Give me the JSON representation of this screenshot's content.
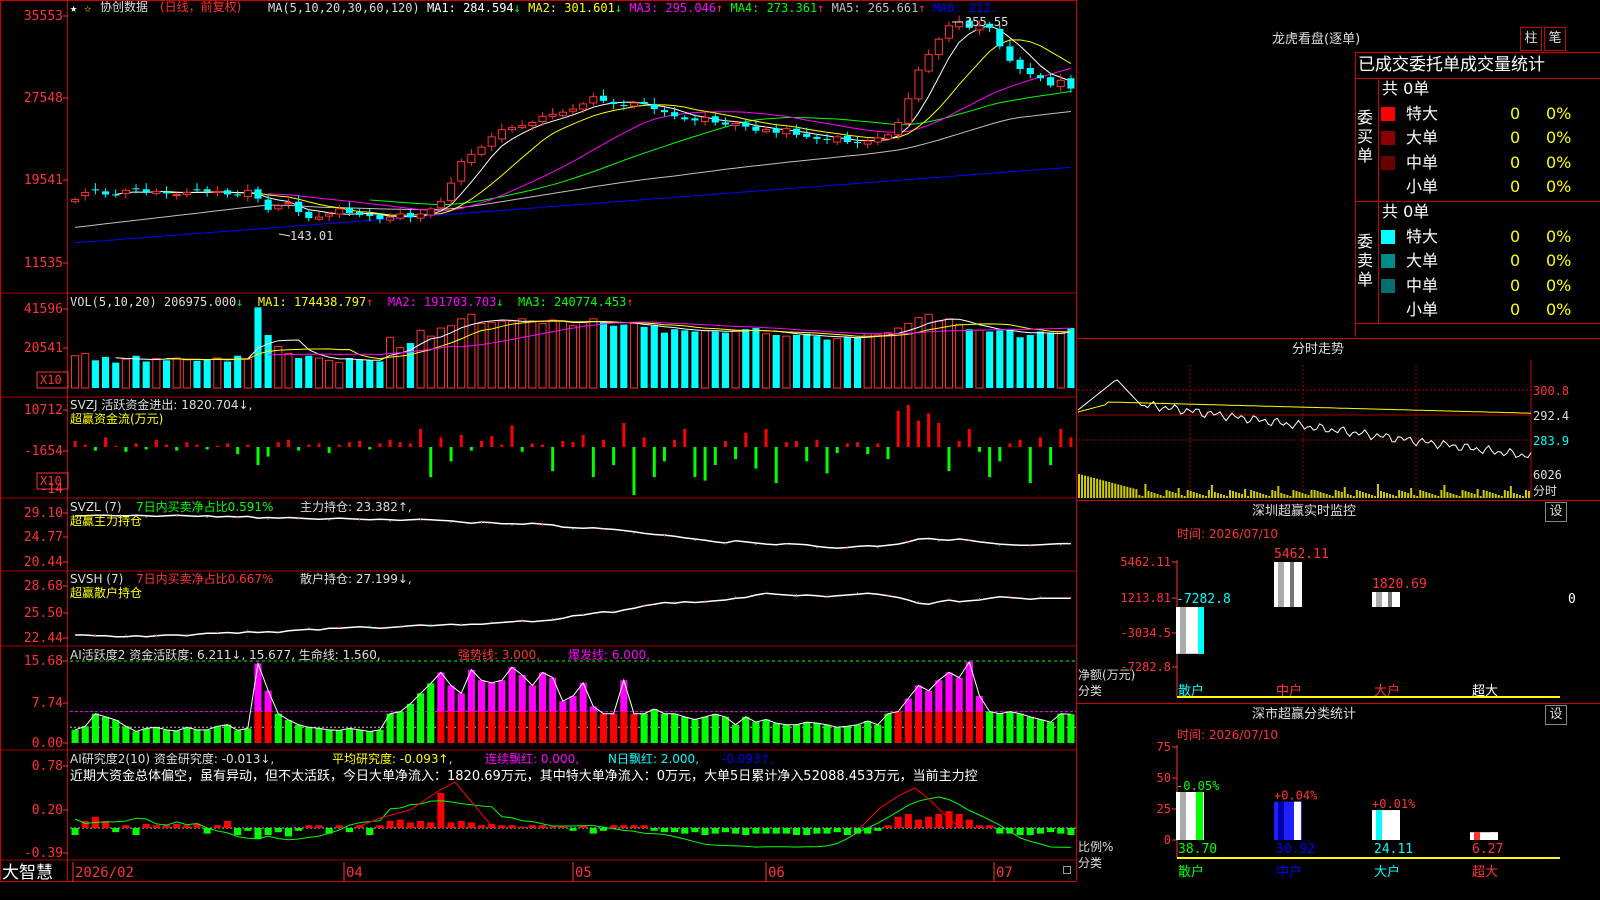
{
  "colors": {
    "up": "#ff3232",
    "down": "#00ffff",
    "grid": "#b00000",
    "ma1": "#ffffff",
    "ma2": "#ffff00",
    "ma3": "#ff00ff",
    "ma4": "#00ff00",
    "ma5": "#c0c0c0",
    "ma6": "#0000ff",
    "green": "#00ff00",
    "red": "#ff0000",
    "yellow": "#ffff00",
    "magenta": "#ff00ff",
    "cyan": "#00ffff",
    "gray": "#c0c0c0"
  },
  "chart_data": [
    {
      "type": "candlestick",
      "title": "协创数据(日线，前复权)",
      "ylim": [
        11535,
        35553
      ],
      "yticks": [
        "35553",
        "27548",
        "19541",
        "11535"
      ],
      "xlabels": [
        "2026/02",
        "04",
        "05",
        "06",
        "07"
      ],
      "high_label": "355.55",
      "low_label": "143.01",
      "ma_label": "MA(5,10,20,30,60,120)",
      "ma_values": [
        {
          "name": "MA1:",
          "value": "284.594",
          "arrow": "↓"
        },
        {
          "name": "MA2:",
          "value": "301.601",
          "arrow": "↓"
        },
        {
          "name": "MA3:",
          "value": "295.046",
          "arrow": "↑"
        },
        {
          "name": "MA4:",
          "value": "273.361",
          "arrow": "↑"
        },
        {
          "name": "MA5:",
          "value": "265.661",
          "arrow": "↑"
        },
        {
          "name": "MA6:",
          "value": "212."
        }
      ],
      "close": [
        177,
        184,
        186,
        182,
        181,
        186,
        187,
        184,
        185,
        183,
        182,
        184,
        186,
        185,
        185,
        182,
        181,
        186,
        178,
        167,
        171,
        174,
        165,
        159,
        160,
        163,
        168,
        164,
        162,
        161,
        158,
        160,
        163,
        160,
        163,
        168,
        175,
        193,
        214,
        221,
        228,
        238,
        245,
        247,
        249,
        252,
        258,
        260,
        262,
        265,
        270,
        277,
        273,
        270,
        268,
        271,
        270,
        265,
        262,
        258,
        255,
        254,
        257,
        252,
        250,
        251,
        248,
        244,
        245,
        242,
        246,
        240,
        238,
        236,
        235,
        238,
        233,
        232,
        234,
        237,
        240,
        252,
        275,
        303,
        318,
        333,
        346,
        350,
        344,
        346,
        344,
        326,
        312,
        304,
        299,
        295,
        288,
        293,
        285
      ],
      "open": [
        175,
        181,
        187,
        185,
        182,
        183,
        188,
        187,
        183,
        185,
        181,
        182,
        187,
        187,
        184,
        186,
        182,
        180,
        187,
        177,
        168,
        173,
        175,
        165,
        158,
        161,
        163,
        169,
        165,
        163,
        162,
        157,
        159,
        164,
        159,
        162,
        169,
        176,
        195,
        213,
        221,
        229,
        236,
        245,
        247,
        249,
        253,
        258,
        259,
        263,
        265,
        271,
        278,
        272,
        269,
        268,
        272,
        270,
        264,
        262,
        257,
        256,
        253,
        258,
        252,
        249,
        252,
        248,
        243,
        246,
        241,
        246,
        241,
        238,
        236,
        233,
        239,
        233,
        231,
        233,
        236,
        240,
        251,
        275,
        302,
        318,
        334,
        345,
        351,
        342,
        348,
        343,
        326,
        313,
        305,
        298,
        296,
        287,
        295
      ]
    },
    {
      "type": "bar",
      "title": "VOL(5,10,20)",
      "yticks": [
        "41596",
        "20541"
      ],
      "unit_label": "X10",
      "indicators": [
        {
          "name": "VOL(5,10,20)",
          "value": "206975.000",
          "arrow": "↓"
        },
        {
          "name": "MA1:",
          "value": "174438.797",
          "arrow": "↑"
        },
        {
          "name": "MA2:",
          "value": "191703.703",
          "arrow": "↓"
        },
        {
          "name": "MA3:",
          "value": "240774.453",
          "arrow": "↑"
        }
      ],
      "values": [
        140,
        150,
        120,
        135,
        110,
        125,
        140,
        115,
        128,
        120,
        130,
        122,
        118,
        125,
        130,
        115,
        140,
        125,
        350,
        230,
        180,
        150,
        130,
        140,
        130,
        120,
        110,
        130,
        125,
        120,
        115,
        220,
        175,
        195,
        250,
        225,
        260,
        270,
        300,
        320,
        280,
        285,
        290,
        290,
        300,
        285,
        280,
        295,
        290,
        270,
        285,
        300,
        290,
        270,
        275,
        280,
        265,
        270,
        240,
        255,
        250,
        245,
        250,
        245,
        240,
        250,
        255,
        260,
        235,
        230,
        225,
        230,
        235,
        225,
        210,
        215,
        220,
        220,
        235,
        230,
        240,
        260,
        280,
        305,
        320,
        290,
        300,
        275,
        255,
        250,
        245,
        250,
        255,
        220,
        230,
        245,
        240,
        245,
        260,
        250
      ]
    },
    {
      "type": "bar",
      "title": "SVZJ 活跃资金进出",
      "yticks": [
        "10712",
        "-1654",
        "-14"
      ],
      "unit_label": "X10",
      "values": [
        0.5,
        0.2,
        -0.3,
        0.8,
        0.1,
        -0.4,
        0.3,
        -0.2,
        0.6,
        0.2,
        -0.3,
        0.4,
        0.2,
        -0.2,
        0.1,
        0.3,
        -0.6,
        0.2,
        -1.5,
        -0.8,
        0.4,
        0.6,
        -0.3,
        0.2,
        0.3,
        -0.5,
        0.2,
        0.4,
        0.5,
        -0.2,
        0.3,
        0.6,
        0.4,
        0.3,
        1.5,
        -2.5,
        0.8,
        -1.2,
        1.0,
        -0.3,
        0.5,
        0.9,
        0.2,
        1.8,
        -0.4,
        0.3,
        0.2,
        -2.0,
        0.5,
        0.4,
        1.0,
        -2.5,
        0.6,
        -1.5,
        2.0,
        -4.0,
        0.8,
        -2.5,
        -1.2,
        0.6,
        1.5,
        -2.5,
        -2.8,
        -1.5,
        0.5,
        -1.0,
        1.2,
        -1.8,
        1.5,
        -3.0,
        0.4,
        0.5,
        -1.2,
        0.6,
        -2.2,
        -0.5,
        0.3,
        0.4,
        -0.6,
        0.3,
        -1.0,
        3.0,
        3.5,
        2.2,
        2.8,
        2.0,
        -2.0,
        0.5,
        1.5,
        -0.4,
        -2.5,
        -1.2,
        0.3,
        0.6,
        -3.0,
        0.8,
        -1.5,
        1.5,
        0.8,
        -0.4
      ]
    },
    {
      "type": "line",
      "title": "SVZL 超赢主力持仓",
      "yticks": [
        "29.10",
        "24.77",
        "20.44"
      ],
      "values": [
        28.6,
        28.6,
        28.7,
        28.7,
        28.6,
        28.6,
        28.7,
        28.6,
        28.5,
        28.6,
        28.7,
        28.6,
        28.5,
        28.6,
        28.4,
        28.5,
        28.4,
        28.5,
        28.2,
        28.3,
        28.2,
        28.3,
        28.2,
        28.1,
        28.0,
        28.1,
        28.2,
        28.1,
        28.0,
        27.9,
        28.0,
        27.9,
        27.8,
        27.9,
        28.0,
        27.9,
        27.8,
        27.7,
        27.5,
        27.3,
        27.5,
        27.4,
        27.2,
        27.2,
        27.1,
        27.3,
        27.1,
        27.0,
        26.6,
        26.5,
        26.4,
        26.5,
        26.3,
        26.2,
        26.0,
        25.8,
        25.5,
        25.3,
        25.2,
        25.0,
        24.7,
        24.5,
        24.3,
        24.0,
        23.8,
        24.2,
        24.0,
        23.8,
        23.6,
        23.5,
        23.7,
        23.6,
        23.5,
        23.2,
        23.0,
        22.9,
        23.0,
        23.2,
        23.3,
        23.2,
        23.4,
        23.6,
        24.0,
        24.5,
        24.6,
        24.4,
        24.3,
        24.5,
        24.3,
        24.0,
        23.8,
        23.6,
        23.5,
        23.4,
        23.4,
        23.5,
        23.6,
        23.7,
        23.7
      ]
    },
    {
      "type": "line",
      "title": "SVSH 超赢散户持仓",
      "yticks": [
        "28.68",
        "25.50",
        "22.44"
      ],
      "values": [
        22.8,
        22.8,
        22.7,
        22.7,
        22.6,
        22.6,
        22.7,
        22.6,
        22.7,
        22.8,
        22.8,
        22.7,
        22.9,
        23.0,
        23.0,
        23.1,
        23.0,
        23.2,
        23.1,
        23.2,
        23.1,
        23.3,
        23.4,
        23.5,
        23.4,
        23.6,
        23.6,
        23.7,
        23.8,
        23.7,
        23.6,
        23.7,
        23.8,
        23.9,
        24.0,
        23.9,
        24.0,
        24.1,
        24.0,
        24.1,
        24.1,
        24.2,
        24.3,
        24.4,
        24.5,
        24.4,
        24.5,
        24.6,
        24.8,
        25.1,
        25.2,
        25.4,
        25.6,
        25.5,
        25.8,
        26.0,
        26.3,
        26.5,
        26.7,
        26.6,
        26.8,
        26.7,
        26.8,
        26.9,
        27.0,
        27.2,
        27.3,
        27.6,
        27.8,
        27.7,
        27.6,
        27.5,
        27.6,
        27.5,
        27.4,
        27.5,
        27.6,
        27.7,
        27.8,
        27.7,
        27.5,
        27.3,
        27.0,
        26.6,
        26.5,
        26.8,
        27.0,
        26.8,
        26.9,
        27.0,
        27.2,
        27.4,
        27.3,
        27.2,
        27.1,
        27.2,
        27.2,
        27.2,
        27.2
      ]
    },
    {
      "type": "bar",
      "title": "AI活跃度2",
      "yticks": [
        "15.68",
        "7.74",
        "0.00"
      ],
      "values": [
        2.5,
        3.2,
        5.6,
        5.0,
        4.4,
        3.2,
        2.2,
        2.8,
        3.0,
        2.5,
        2.3,
        3.0,
        2.5,
        2.5,
        3.2,
        3.5,
        2.4,
        2.8,
        15.2,
        10.0,
        5.6,
        4.4,
        3.5,
        3.0,
        2.8,
        2.5,
        2.4,
        2.8,
        2.5,
        2.2,
        2.5,
        5.6,
        6.0,
        7.5,
        9.5,
        11.4,
        13.5,
        11.0,
        9.5,
        14.0,
        12.0,
        11.5,
        12.0,
        14.5,
        13.0,
        11.0,
        13.5,
        12.5,
        8.0,
        9.0,
        11.5,
        7.0,
        5.6,
        5.6,
        12.0,
        5.6,
        5.6,
        6.5,
        5.6,
        5.6,
        5.0,
        4.5,
        5.0,
        5.5,
        5.0,
        3.5,
        5.0,
        4.0,
        4.5,
        3.8,
        3.5,
        3.5,
        4.0,
        3.8,
        3.5,
        3.0,
        3.2,
        3.5,
        4.2,
        3.5,
        5.6,
        6.0,
        8.5,
        11.0,
        10.0,
        12.0,
        13.5,
        12.5,
        15.5,
        9.0,
        6.0,
        5.6,
        6.0,
        5.6,
        5.0,
        4.5,
        4.0,
        5.6,
        5.5,
        5.0
      ]
    },
    {
      "type": "bar",
      "title": "AI研究度2(10)",
      "yticks": [
        "0.78",
        "0.20",
        "-0.39"
      ],
      "values": [
        -0.05,
        0.05,
        0.08,
        0.05,
        -0.03,
        0.02,
        -0.05,
        0.03,
        0.02,
        0.02,
        0.03,
        0.02,
        0.03,
        -0.04,
        0.02,
        0.05,
        -0.05,
        -0.02,
        -0.08,
        -0.05,
        -0.03,
        -0.06,
        -0.02,
        0.02,
        0.02,
        -0.04,
        0.02,
        -0.03,
        0.02,
        -0.05,
        0.02,
        0.05,
        0.06,
        0.04,
        0.05,
        0.04,
        0.25,
        0.04,
        0.05,
        0.04,
        0.02,
        0.03,
        0.02,
        0.02,
        0.01,
        0.02,
        0.02,
        0.01,
        0.01,
        -0.02,
        0.02,
        -0.04,
        -0.02,
        0.02,
        0.02,
        0.02,
        0.02,
        -0.02,
        -0.03,
        -0.03,
        -0.04,
        -0.03,
        -0.05,
        -0.04,
        -0.03,
        -0.04,
        -0.05,
        -0.04,
        -0.04,
        -0.04,
        -0.04,
        -0.05,
        -0.05,
        -0.04,
        -0.04,
        -0.03,
        -0.05,
        -0.04,
        -0.04,
        -0.02,
        0.02,
        0.08,
        0.1,
        0.06,
        0.08,
        0.1,
        0.12,
        0.1,
        0.06,
        0.02,
        0.02,
        -0.04,
        -0.04,
        -0.05,
        -0.05,
        -0.04,
        -0.03,
        -0.04,
        -0.05,
        -0.04
      ]
    },
    {
      "type": "bar",
      "title": "深圳超赢实时监控",
      "categories": [
        "散户",
        "中户",
        "大户",
        "超大"
      ],
      "values": [
        -7282.8,
        5462.11,
        1820.69,
        0
      ],
      "value_labels": [
        "-7282.8",
        "5462.11",
        "1820.69",
        "0"
      ],
      "yticks": [
        "5462.11",
        "1213.81",
        "-3034.5",
        "-7282.8"
      ]
    },
    {
      "type": "bar",
      "title": "深市超赢分类统计",
      "categories": [
        "散户",
        "中户",
        "大户",
        "超大"
      ],
      "values": [
        38.7,
        30.92,
        24.11,
        6.27
      ],
      "value_labels": [
        "38.70",
        "30.92",
        "24.11",
        "6.27"
      ],
      "change_labels": [
        "-0.05%",
        "+0.04%",
        "+0.01%",
        ""
      ],
      "yticks": [
        "75",
        "50",
        "25",
        "0"
      ]
    }
  ],
  "labels": {
    "app_name": "大智慧",
    "stock_name": "协创数据",
    "stock_mode": "(日线，前复权)",
    "svzj_title": "SVZJ  活跃资金进出: 1820.704↓,",
    "svzj_sub": "超赢资金流(万元)",
    "svzl_title": "SVZL (7)",
    "svzl_ratio": "7日内买卖净占比0.591%",
    "svzl_hold": "主力持仓: 23.382↑,",
    "svzl_sub": "超赢主力持仓",
    "svsh_title": "SVSH (7)",
    "svsh_ratio": "7日内买卖净占比0.667%",
    "svsh_hold": "散户持仓: 27.199↓,",
    "svsh_sub": "超赢散户持仓",
    "ai1_a": "AI活跃度2 资金活跃度: 6.211↓, 15.677, 生命线: 1.560,",
    "ai1_b": "强势线: 3.000,",
    "ai1_c": "爆发线: 6.000,",
    "ai2_a": "AI研究度2(10)  资金研究度: -0.013↓,",
    "ai2_b": "平均研究度: -0.093↑,",
    "ai2_c": "连续飘红: 0.000,",
    "ai2_d": "N日飘红: 2.000,",
    "ai2_e": "-0.093↑,",
    "ai2_desc": "近期大资金总体偏空，虽有异动，但不太活跃，今日大单净流入：1820.69万元，其中特大单净流入：0万元，大单5日累计净入52088.453万元，当前主力控"
  },
  "right": {
    "lhb_title": "龙虎看盘(逐单)",
    "btn_zhu": "柱",
    "btn_bi": "笔",
    "tabs": "已成交委托单成交量统计",
    "buy_label": "委买单",
    "sell_label": "委卖单",
    "buy_total": "共 0单",
    "sell_total": "共 0单",
    "buy_rows": [
      {
        "name": "特大",
        "count": "0",
        "pct": "0%"
      },
      {
        "name": "大单",
        "count": "0",
        "pct": "0%"
      },
      {
        "name": "中单",
        "count": "0",
        "pct": "0%"
      },
      {
        "name": "小单",
        "count": "0",
        "pct": "0%"
      }
    ],
    "sell_rows": [
      {
        "name": "特大",
        "count": "0",
        "pct": "0%"
      },
      {
        "name": "大单",
        "count": "0",
        "pct": "0%"
      },
      {
        "name": "中单",
        "count": "0",
        "pct": "0%"
      },
      {
        "name": "小单",
        "count": "0",
        "pct": "0%"
      }
    ],
    "fs_title": "分时走势",
    "fs_prices": [
      "300.8",
      "292.4",
      "283.9"
    ],
    "fs_vol": "6026",
    "fs_unit": "分时",
    "sz_title": "深圳超赢实时监控",
    "sz_time": "时间: 2026/07/10",
    "set_btn": "设",
    "sz_axis1": "净额(万元)",
    "sz_axis2": "分类",
    "stat_title": "深市超赢分类统计",
    "stat_time": "时间: 2026/07/10",
    "stat_axis1": "比例%",
    "stat_axis2": "分类"
  }
}
